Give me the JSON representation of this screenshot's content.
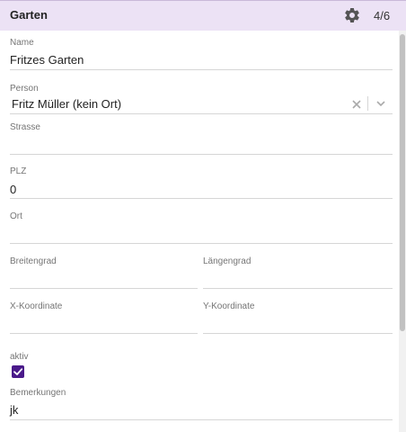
{
  "header": {
    "title": "Garten",
    "settings_icon": "gear-icon",
    "counter": "4/6"
  },
  "form": {
    "name": {
      "label": "Name",
      "value": "Fritzes Garten"
    },
    "person": {
      "label": "Person",
      "value": "Fritz Müller (kein Ort)",
      "clear_icon": "close-icon",
      "dropdown_icon": "chevron-down-icon"
    },
    "strasse": {
      "label": "Strasse",
      "value": ""
    },
    "plz": {
      "label": "PLZ",
      "value": "0"
    },
    "ort": {
      "label": "Ort",
      "value": ""
    },
    "breitengrad": {
      "label": "Breitengrad",
      "value": ""
    },
    "laengengrad": {
      "label": "Längengrad",
      "value": ""
    },
    "x_koordinate": {
      "label": "X-Koordinate",
      "value": ""
    },
    "y_koordinate": {
      "label": "Y-Koordinate",
      "value": ""
    },
    "aktiv": {
      "label": "aktiv",
      "checked": true
    },
    "bemerkungen": {
      "label": "Bemerkungen",
      "value": "jk"
    }
  },
  "colors": {
    "header_bg": "#ece2f5",
    "checkbox_accent": "#4a1a8a"
  }
}
